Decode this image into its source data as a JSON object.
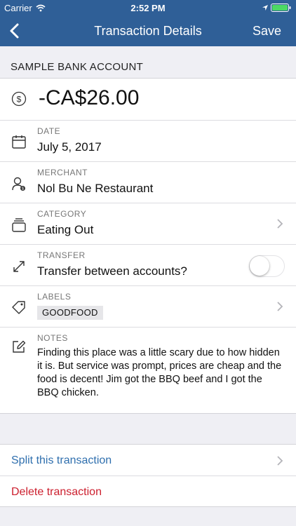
{
  "status_bar": {
    "carrier": "Carrier",
    "time": "2:52 PM"
  },
  "nav": {
    "title": "Transaction Details",
    "save_label": "Save"
  },
  "account": {
    "name": "SAMPLE BANK ACCOUNT"
  },
  "amount": "-CA$26.00",
  "date": {
    "label": "DATE",
    "value": "July 5, 2017"
  },
  "merchant": {
    "label": "MERCHANT",
    "value": "Nol Bu Ne Restaurant"
  },
  "category": {
    "label": "CATEGORY",
    "value": "Eating Out"
  },
  "transfer": {
    "label": "TRANSFER",
    "value": "Transfer between accounts?",
    "enabled": false
  },
  "labels": {
    "label": "LABELS",
    "items": [
      "GOODFOOD"
    ]
  },
  "notes": {
    "label": "NOTES",
    "value": "Finding this place was a little scary due to how hidden it is. But service was prompt, prices are cheap and the food is decent! Jim got the BBQ beef and I got the BBQ chicken."
  },
  "actions": {
    "split_label": "Split this transaction",
    "delete_label": "Delete transaction"
  },
  "colors": {
    "nav_bg": "#2f5f97",
    "link": "#2f6fae",
    "destructive": "#cc1f2e"
  }
}
